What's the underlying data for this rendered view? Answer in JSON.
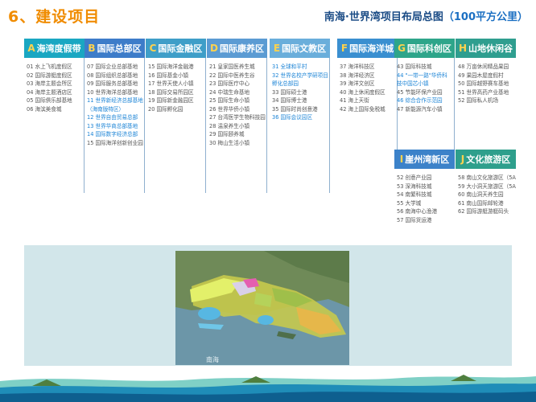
{
  "header": {
    "title": "6、建设项目",
    "layout_title": "南海·世界湾项目布局总图",
    "unit": "（100平方公里）"
  },
  "columns": [
    {
      "letter": "A",
      "name": "海湾度假带",
      "color": "#1aa7c2",
      "items": [
        {
          "text": "01 水上飞机度假区"
        },
        {
          "text": "02 国际游艇度假区"
        },
        {
          "text": "03 海岸主题会所区"
        },
        {
          "text": "04 海岸主题酒店区"
        },
        {
          "text": "05 国际俱乐部基地"
        },
        {
          "text": "06 海滨美食城"
        }
      ]
    },
    {
      "letter": "B",
      "name": "国际总部区",
      "color": "#3d7cc9",
      "items": [
        {
          "text": "07 国际企业总部基地"
        },
        {
          "text": "08 国际组织总部基地"
        },
        {
          "text": "09 国际服务总部基地"
        },
        {
          "text": "10 世界海洋总部基地"
        },
        {
          "text": "11 世界新经济总部基地",
          "hl": true
        },
        {
          "text": "（海南版特区）",
          "hl": true
        },
        {
          "text": "12 世界自由贸易总部",
          "hl": true
        },
        {
          "text": "13 世界华商总部基地",
          "hl": true
        },
        {
          "text": "14 国际数字经济总部",
          "hl": true
        },
        {
          "text": "15 国际海洋创新创业园"
        }
      ]
    },
    {
      "letter": "C",
      "name": "国际金融区",
      "color": "#3f9ec8",
      "items": [
        {
          "text": "15 国际海洋金融港"
        },
        {
          "text": "16 国际基金小镇"
        },
        {
          "text": "17 世界天使人小镇"
        },
        {
          "text": "18 国际交易所园区"
        },
        {
          "text": "19 国际新金融园区"
        },
        {
          "text": "20 国际孵化园"
        }
      ]
    },
    {
      "letter": "D",
      "name": "国际康养区",
      "color": "#5b9bd3",
      "items": [
        {
          "text": "21 皇家国医养生城"
        },
        {
          "text": "22 国际中医养生谷"
        },
        {
          "text": "23 国际医疗中心"
        },
        {
          "text": "24 中瑞生命基地"
        },
        {
          "text": "25 国际生命小镇"
        },
        {
          "text": "26 世界华侨小镇"
        },
        {
          "text": "27 台湾医学生物科技园"
        },
        {
          "text": "28 温泉养生小镇"
        },
        {
          "text": "29 国际颐养城"
        },
        {
          "text": "30 梅山生活小镇"
        }
      ]
    },
    {
      "letter": "E",
      "name": "国际文教区",
      "color": "#6aaedb",
      "items": [
        {
          "text": "31 全球和平村",
          "hl": true
        },
        {
          "text": "32 世界名校产学研项目",
          "hl": true
        },
        {
          "text": "孵化总部园",
          "hl": true
        },
        {
          "text": "33 国际硕士港"
        },
        {
          "text": "34 国际博士港"
        },
        {
          "text": "35 国际时尚创意港"
        },
        {
          "text": "36 国际会议园区",
          "hl": true
        }
      ]
    },
    {
      "letter": "F",
      "name": "国际海洋城",
      "color": "#3a8fd0",
      "items": [
        {
          "text": "37 海洋科技区"
        },
        {
          "text": "38 海洋经济区"
        },
        {
          "text": "39 海洋文创区"
        },
        {
          "text": "40 海上休闲度假区"
        },
        {
          "text": "41 海上天街"
        },
        {
          "text": "42 海上国际免税城"
        }
      ]
    },
    {
      "letter": "G",
      "name": "国际科创区",
      "color": "#2ea58a",
      "items": [
        {
          "text": "43 国际科技城"
        },
        {
          "text": "44 \"一带一路\"华侨科",
          "hl": true
        },
        {
          "text": "技中国芯小镇",
          "hl": true
        },
        {
          "text": "45 节能环保产业园"
        },
        {
          "text": "46 综合合作示范园",
          "hl": true
        },
        {
          "text": "47 新能源汽车小镇"
        }
      ]
    },
    {
      "letter": "H",
      "name": "山地休闲谷",
      "color": "#2f9e8f",
      "items": [
        {
          "text": "48 万亩休闲精品果园"
        },
        {
          "text": "49 果园木屋度假村"
        },
        {
          "text": "50 国际越野赛车基地"
        },
        {
          "text": "51 世界高药产业基地"
        },
        {
          "text": "52 国际私人机场"
        }
      ]
    }
  ],
  "sub_columns": [
    {
      "letter": "I",
      "name": "崖州湾新区",
      "color": "#3c82c9",
      "items": [
        {
          "text": "52 创意产业园"
        },
        {
          "text": "53 深海科技城"
        },
        {
          "text": "54 南繁科技城"
        },
        {
          "text": "55 大学城"
        },
        {
          "text": "56 南海中心渔港"
        },
        {
          "text": "57 国际货运港"
        }
      ]
    },
    {
      "letter": "J",
      "name": "文化旅游区",
      "color": "#2e9f8c",
      "items": [
        {
          "text": "58 南山文化旅游区（5A级）"
        },
        {
          "text": "59 大小洞天旅游区（5A级）"
        },
        {
          "text": "60 南山洞天养生园"
        },
        {
          "text": "61 南山国际邮轮港"
        },
        {
          "text": "62 国际游艇游艇码头"
        }
      ]
    }
  ],
  "map": {
    "sea_label": "南海"
  }
}
